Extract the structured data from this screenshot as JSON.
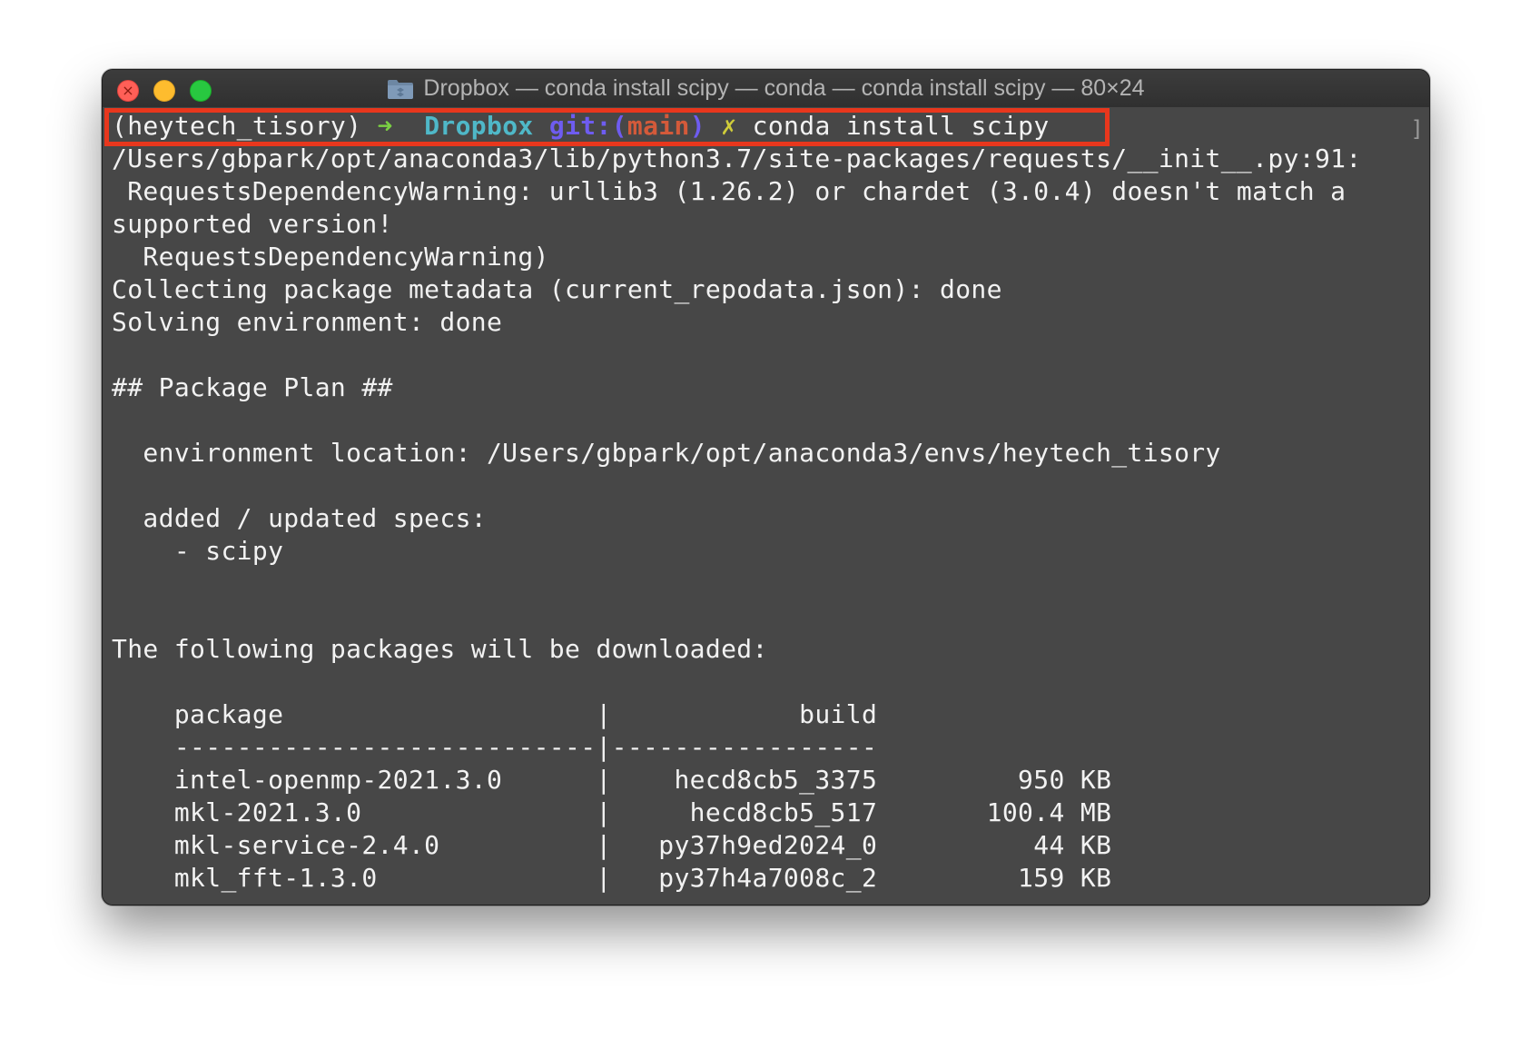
{
  "window": {
    "title": "Dropbox — conda install scipy — conda — conda install scipy — 80×24",
    "close_glyph": "×",
    "icons": {
      "close": "close-icon",
      "minimize": "minimize-icon",
      "zoom": "zoom-icon",
      "folder": "folder-icon"
    }
  },
  "colors": {
    "highlight_box": "#e8371d",
    "prompt_arrow": "#7ad043",
    "prompt_dir": "#4fb8c8",
    "prompt_git": "#6e5cf0",
    "prompt_branch": "#d45a3a",
    "prompt_dirty": "#cfcc3a",
    "terminal_bg": "#474747"
  },
  "prompt": {
    "env": "(heytech_tisory)",
    "arrow": "➜",
    "dir": "Dropbox",
    "git_open": "git:(",
    "branch": "main",
    "git_close": ")",
    "dirty": "✗",
    "command": "conda install scipy"
  },
  "scroll_marker": "]",
  "output_lines": [
    "/Users/gbpark/opt/anaconda3/lib/python3.7/site-packages/requests/__init__.py:91:",
    " RequestsDependencyWarning: urllib3 (1.26.2) or chardet (3.0.4) doesn't match a",
    "supported version!",
    "  RequestsDependencyWarning)",
    "Collecting package metadata (current_repodata.json): done",
    "Solving environment: done",
    "",
    "## Package Plan ##",
    "",
    "  environment location: /Users/gbpark/opt/anaconda3/envs/heytech_tisory",
    "",
    "  added / updated specs:",
    "    - scipy",
    "",
    "",
    "The following packages will be downloaded:",
    "",
    "    package                    |            build",
    "    ---------------------------|-----------------",
    "    intel-openmp-2021.3.0      |    hecd8cb5_3375         950 KB",
    "    mkl-2021.3.0               |     hecd8cb5_517       100.4 MB",
    "    mkl-service-2.4.0          |   py37h9ed2024_0          44 KB",
    "    mkl_fft-1.3.0              |   py37h4a7008c_2         159 KB"
  ]
}
